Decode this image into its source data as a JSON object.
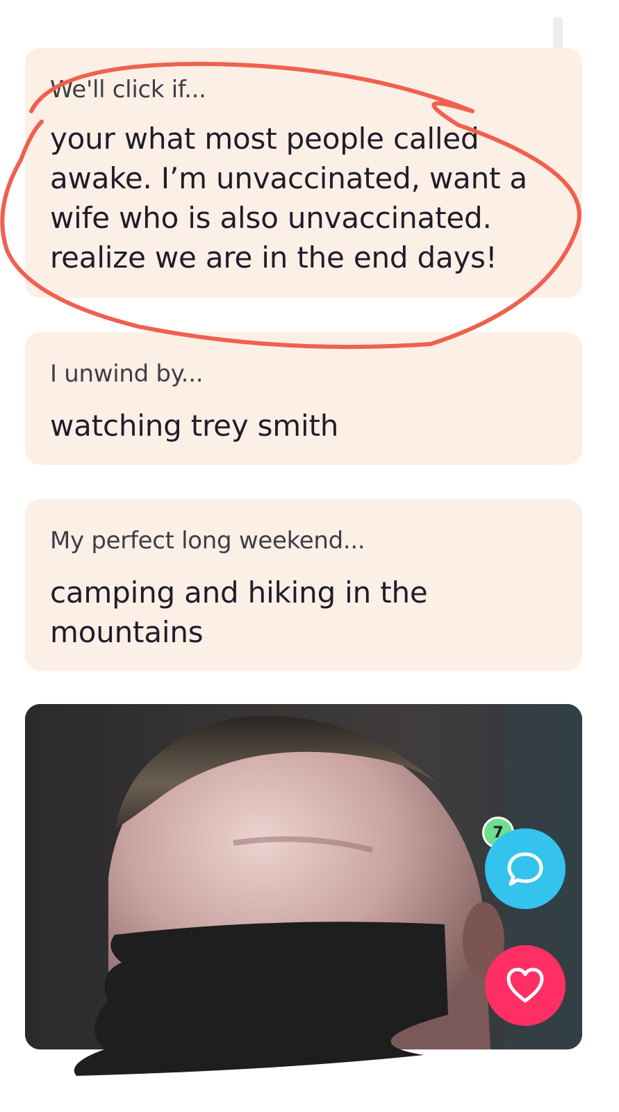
{
  "prompts": [
    {
      "question": "We'll click if...",
      "answer": "your what most people called awake. I’m unvaccinated, want a wife who is also unvaccinated. realize we are in the end days!"
    },
    {
      "question": "I unwind by...",
      "answer": "watching trey smith"
    },
    {
      "question": "My perfect long weekend...",
      "answer": "camping and hiking in the mountains"
    }
  ],
  "chat": {
    "badge_count": "7",
    "icon": "chat-bubble-icon"
  },
  "like": {
    "icon": "heart-icon"
  },
  "colors": {
    "card_bg": "#fcefe5",
    "chat_button": "#33c3ee",
    "like_button": "#ff2e63",
    "badge": "#6fde8e",
    "annotation": "#f0604f"
  }
}
